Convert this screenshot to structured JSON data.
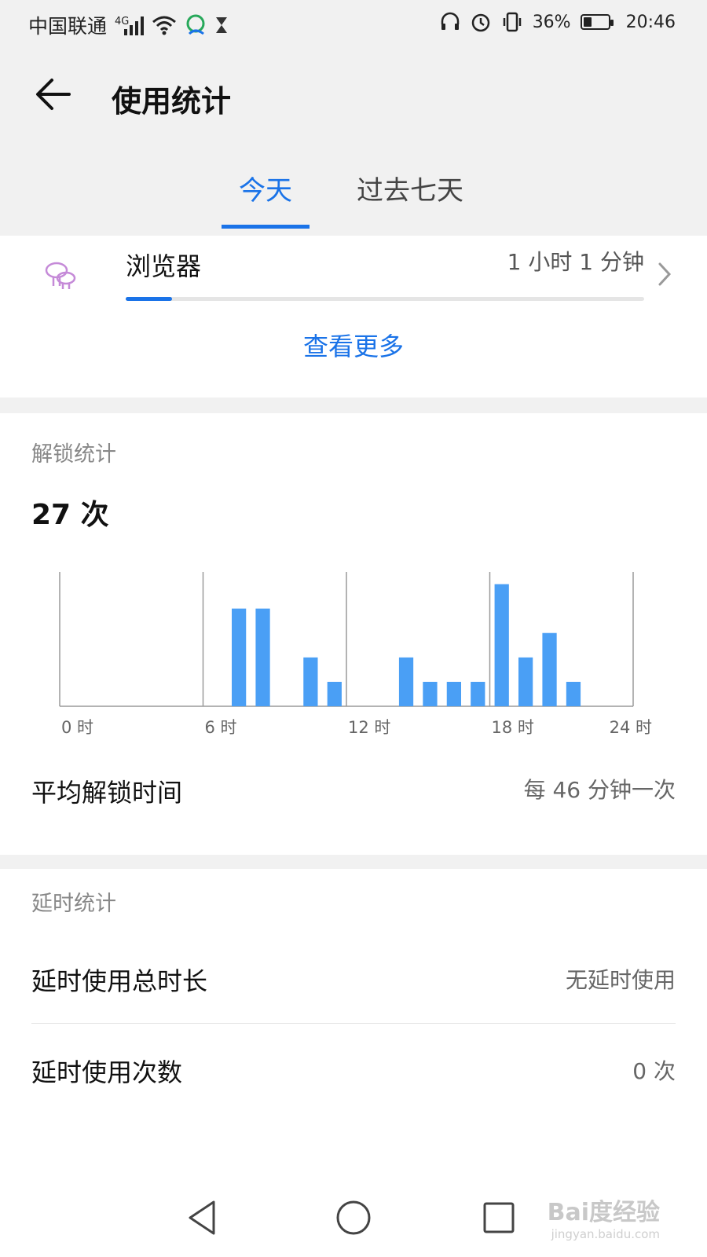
{
  "status_bar": {
    "carrier": "中国联通",
    "network": "4G",
    "battery": "36%",
    "battery_level": 0.36,
    "time": "20:46"
  },
  "header": {
    "title": "使用统计"
  },
  "tabs": [
    {
      "label": "今天",
      "active": true
    },
    {
      "label": "过去七天",
      "active": false
    }
  ],
  "app_usage": {
    "name": "浏览器",
    "duration": "1 小时 1 分钟",
    "progress": 0.09
  },
  "see_more_label": "查看更多",
  "unlock": {
    "section_label": "解锁统计",
    "count": "27 次",
    "avg_label": "平均解锁时间",
    "avg_value": "每 46 分钟一次"
  },
  "chart_data": {
    "type": "bar",
    "x": [
      7,
      8,
      10,
      11,
      14,
      15,
      16,
      17,
      18,
      19,
      20,
      21
    ],
    "values": [
      4,
      4,
      2,
      1,
      2,
      1,
      1,
      1,
      5,
      2,
      3,
      1
    ],
    "xlim": [
      0,
      24
    ],
    "ylim": [
      0,
      5.5
    ],
    "x_ticks": [
      {
        "value": 0,
        "label": "0 时"
      },
      {
        "value": 6,
        "label": "6 时"
      },
      {
        "value": 12,
        "label": "12 时"
      },
      {
        "value": 18,
        "label": "18 时"
      },
      {
        "value": 24,
        "label": "24 时"
      }
    ],
    "grid": true,
    "bar_color": "#4a9ff5",
    "line_color": "#9a9a9a"
  },
  "delay": {
    "section_label": "延时统计",
    "total_label": "延时使用总时长",
    "total_value": "无延时使用",
    "count_label": "延时使用次数",
    "count_value": "0 次"
  },
  "watermark": {
    "brand": "Bai度经验",
    "url": "jingyan.baidu.com"
  },
  "colors": {
    "accent": "#1a73e8",
    "background": "#f1f1f1"
  }
}
